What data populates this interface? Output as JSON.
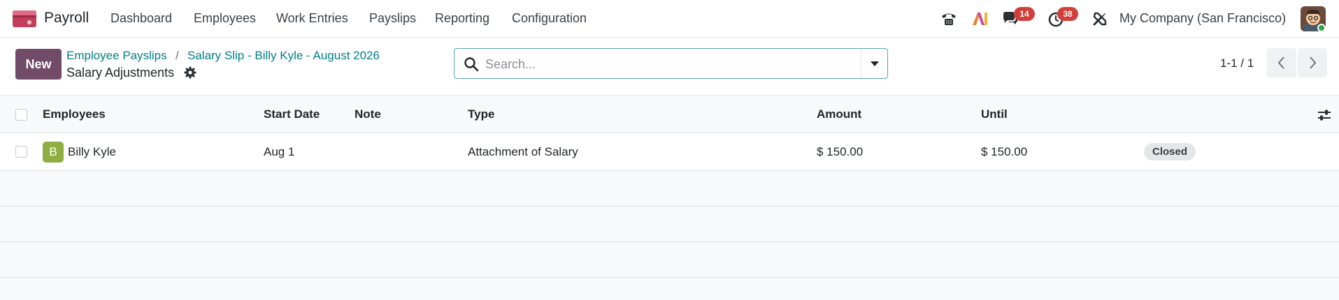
{
  "navbar": {
    "app_name": "Payroll",
    "menu": [
      "Dashboard",
      "Employees",
      "Work Entries",
      "Payslips",
      "Reporting",
      "Configuration"
    ],
    "icons": [
      "phone-icon",
      "ai-icon",
      "chat-icon",
      "clock-icon",
      "tools-icon"
    ],
    "messages_count": "14",
    "activities_count": "38",
    "company": "My Company (San Francisco)"
  },
  "control": {
    "new_label": "New",
    "breadcrumbs": [
      "Employee Payslips",
      "Salary Slip - Billy Kyle - August 2026"
    ],
    "separator": "/",
    "title": "Salary Adjustments",
    "search_placeholder": "Search...",
    "pager": "1-1 / 1"
  },
  "table": {
    "columns": [
      "Employees",
      "Start Date",
      "Note",
      "Type",
      "Amount",
      "Until"
    ],
    "rows": [
      {
        "initial": "B",
        "employee": "Billy Kyle",
        "start_date": "Aug 1",
        "note": "",
        "type": "Attachment of Salary",
        "amount": "$ 150.00",
        "until": "$ 150.00",
        "status": "Closed"
      }
    ]
  },
  "colors": {
    "brand": "#714b67",
    "link": "#017e84",
    "badge": "#d23f3a",
    "employee_avatar": "#8fae42"
  }
}
